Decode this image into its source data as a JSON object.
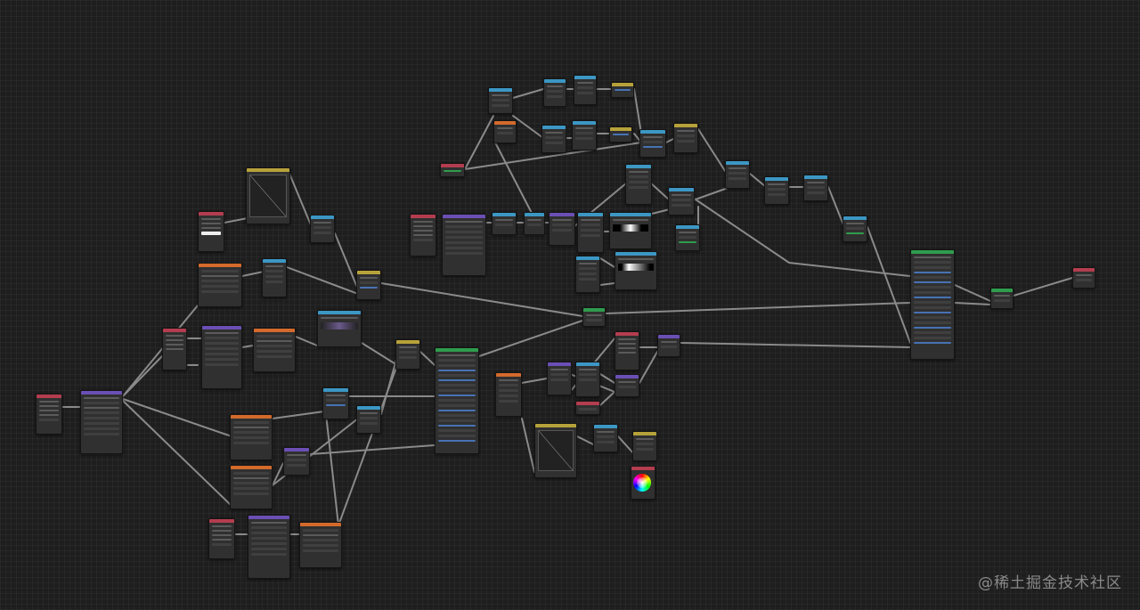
{
  "watermark": "@稀土掘金技术社区",
  "colors": {
    "input": "#b33d4f",
    "shader": "#2f9c4d",
    "texture": "#d36a2c",
    "color": "#b7a23a",
    "vector": "#6b4fb5",
    "converter": "#3c97c4",
    "link": "#8d8d8d"
  }
}
